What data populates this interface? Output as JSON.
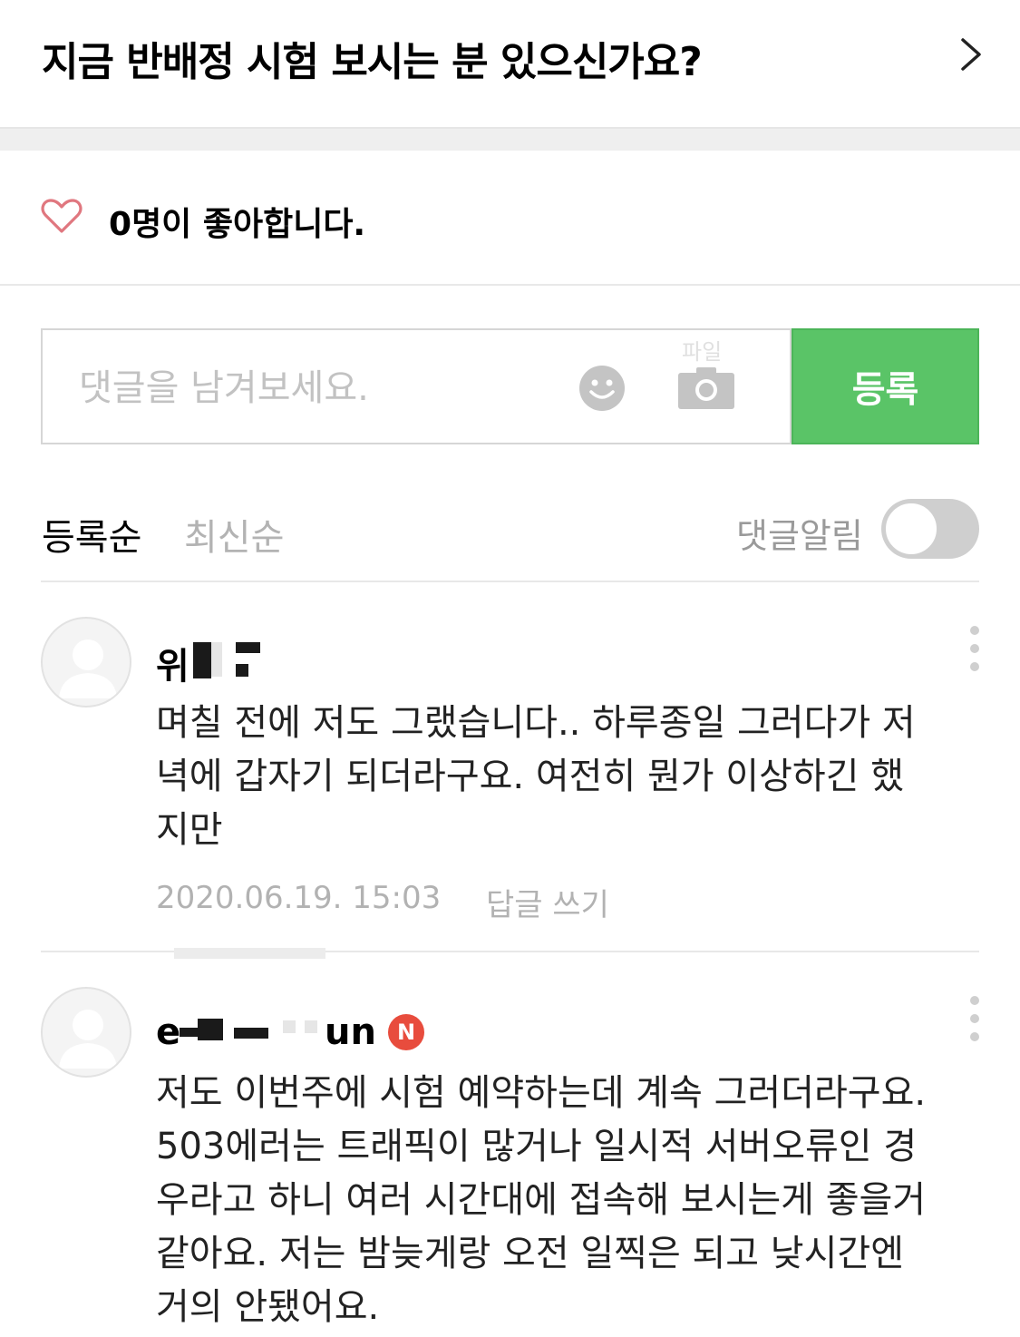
{
  "header": {
    "title": "지금 반배정 시험 보시는 분 있으신가요?",
    "chevron_icon": "chevron-right-icon"
  },
  "likes": {
    "count": "0",
    "suffix": "명이 좋아합니다.",
    "icon": "heart-outline-icon",
    "heart_color": "#e0777f"
  },
  "comment_input": {
    "placeholder": "댓글을 남겨보세요.",
    "emoji_icon": "smiley-icon",
    "camera_icon": "camera-icon",
    "camera_hint": "파일",
    "submit_label": "등록",
    "submit_color": "#5ac467"
  },
  "sort": {
    "options": [
      "등록순",
      "최신순"
    ],
    "selected": "등록순",
    "notify_label": "댓글알림",
    "notify_on": false
  },
  "comments": [
    {
      "name_visible": "위",
      "body": "며칠 전에 저도 그랬습니다.. 하루종일 그러다가 저녁에 갑자기 되더라구요. 여전히 뭔가 이상하긴 했지만",
      "date": "2020.06.19. 15:03",
      "reply_label": "답글 쓰기"
    },
    {
      "name_prefix": "e",
      "name_suffix": "un",
      "badge": "N",
      "badge_color": "#e84c3d",
      "body": "저도 이번주에 시험 예약하는데 계속 그러더라구요. 503에러는 트래픽이 많거나 일시적 서버오류인 경우라고 하니 여러 시간대에 접속해 보시는게 좋을거 같아요. 저는 밤늦게랑 오전 일찍은 되고 낮시간엔 거의 안됐어요."
    }
  ]
}
